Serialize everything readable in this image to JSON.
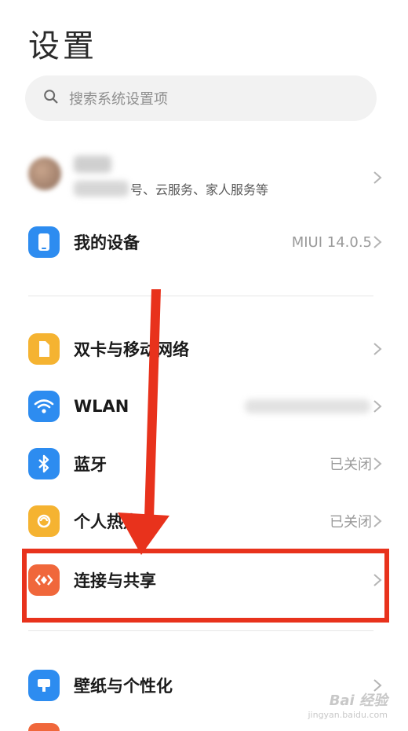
{
  "header": {
    "title": "设置"
  },
  "search": {
    "placeholder": "搜索系统设置项"
  },
  "account": {
    "subtitle": "号、云服务、家人服务等"
  },
  "rows": [
    {
      "id": "my-device",
      "label": "我的设备",
      "value": "MIUI 14.0.5",
      "icon": "phone-icon",
      "color": "#2d8cf0"
    },
    {
      "id": "dual-sim",
      "label": "双卡与移动网络",
      "value": "",
      "icon": "sim-card-icon",
      "color": "#f5b331"
    },
    {
      "id": "wlan",
      "label": "WLAN",
      "value": "",
      "icon": "wifi-icon",
      "color": "#2d8cf0"
    },
    {
      "id": "bluetooth",
      "label": "蓝牙",
      "value": "已关闭",
      "icon": "bluetooth-icon",
      "color": "#2d8cf0"
    },
    {
      "id": "hotspot",
      "label": "个人热点",
      "value": "已关闭",
      "icon": "hotspot-icon",
      "color": "#f5b331"
    },
    {
      "id": "connection-sharing",
      "label": "连接与共享",
      "value": "",
      "icon": "connection-sharing-icon",
      "color": "#f0673b"
    },
    {
      "id": "wallpaper",
      "label": "壁纸与个性化",
      "value": "",
      "icon": "wallpaper-icon",
      "color": "#2d8cf0"
    }
  ],
  "annotation": {
    "arrow_color": "#e8321c",
    "box_color": "#e8321c"
  },
  "watermark": {
    "line1": "Bai 经验",
    "line2": "jingyan.baidu.com"
  }
}
